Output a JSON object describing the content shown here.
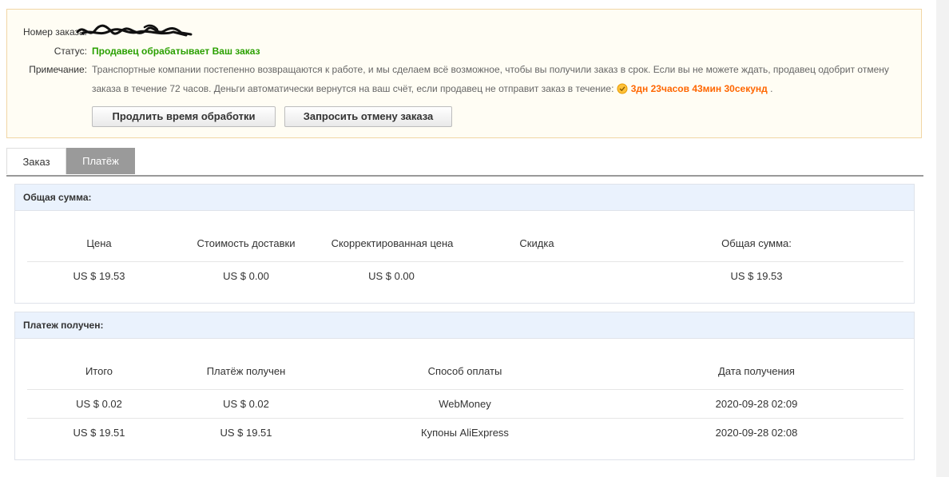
{
  "order": {
    "number_label": "Номер заказа:",
    "status_label": "Статус:",
    "status_value": "Продавец обрабатывает Ваш заказ",
    "note_label": "Примечание:",
    "note_line1": "Транспортные компании постепенно возвращаются к работе, и мы сделаем всё возможное, чтобы вы получили заказ в срок. Если вы не можете ждать, продавец одобрит отмену",
    "note_line2": "заказа в течение 72 часов. Деньги автоматически вернутся на ваш счёт, если продавец не отправит заказ в течение:",
    "timer": "3дн 23часов 43мин 30секунд",
    "timer_suffix": ".",
    "extend_button": "Продлить время обработки",
    "cancel_button": "Запросить отмену заказа",
    "timer_color": "#ff6600",
    "status_color": "#2aa000"
  },
  "tabs": [
    {
      "label": "Заказ",
      "active": false
    },
    {
      "label": "Платёж",
      "active": true
    }
  ],
  "total": {
    "title": "Общая сумма:",
    "headers": [
      "Цена",
      "Стоимость доставки",
      "Скорректированная цена",
      "Скидка",
      "Общая сумма:"
    ],
    "row": [
      "US $ 19.53",
      "US $ 0.00",
      "US $ 0.00",
      "",
      "US $ 19.53"
    ]
  },
  "payment": {
    "title": "Платеж получен:",
    "headers": [
      "Итого",
      "Платёж получен",
      "Способ оплаты",
      "Дата получения"
    ],
    "rows": [
      [
        "US $ 0.02",
        "US $ 0.02",
        "WebMoney",
        "2020-09-28 02:09"
      ],
      [
        "US $ 19.51",
        "US $ 19.51",
        "Купоны AliExpress",
        "2020-09-28 02:08"
      ]
    ]
  }
}
